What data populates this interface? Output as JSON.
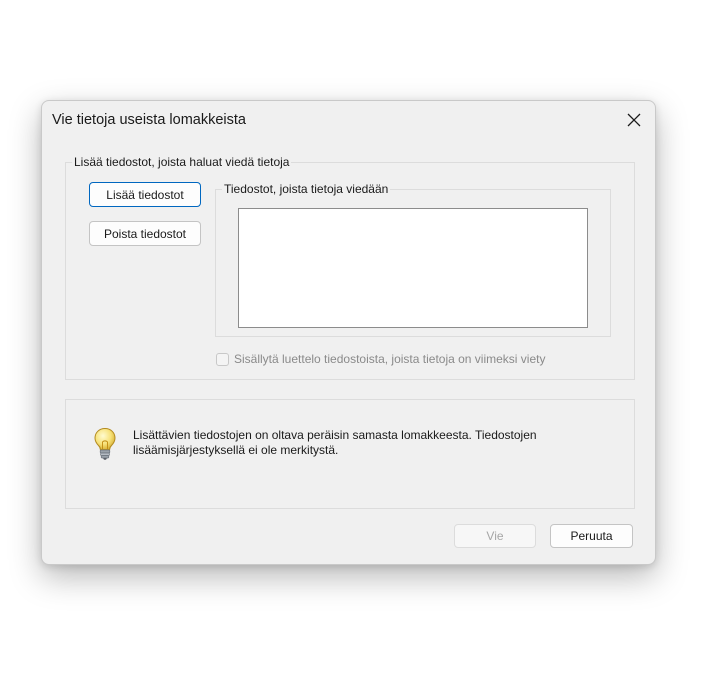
{
  "dialog": {
    "title": "Vie tietoja useista lomakkeista",
    "close_icon": "close-icon"
  },
  "add_files_group": {
    "legend": "Lisää tiedostot, joista haluat viedä tietoja",
    "add_button": "Lisää tiedostot",
    "remove_button": "Poista tiedostot",
    "files_group": {
      "legend": "Tiedostot, joista tietoja viedään",
      "items": []
    },
    "include_checkbox": {
      "label": "Sisällytä luettelo tiedostoista, joista tietoja on viimeksi viety",
      "checked": false,
      "enabled": false
    }
  },
  "info": {
    "icon": "lightbulb-icon",
    "text_line1": "Lisättävien tiedostojen on oltava peräisin samasta lomakkeesta. Tiedostojen",
    "text_line2": "lisäämisjärjestyksellä ei ole merkitystä."
  },
  "footer": {
    "export_button": "Vie",
    "export_enabled": false,
    "cancel_button": "Peruuta"
  },
  "colors": {
    "dialog_bg": "#f0f0f0",
    "focus_accent": "#0067c0",
    "disabled_text": "#a6a6a6"
  }
}
